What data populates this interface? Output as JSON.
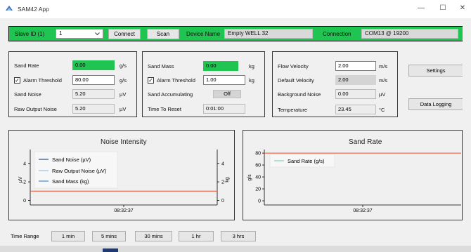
{
  "window": {
    "title": "SAM42 App",
    "minimize_glyph": "—",
    "maximize_glyph": "☐",
    "close_glyph": "✕"
  },
  "topbar": {
    "slave_id_label": "Slave ID (1)",
    "slave_id_value": "1",
    "connect_label": "Connect",
    "scan_label": "Scan",
    "device_name_label": "Device Name",
    "device_name_value": "Empty WELL 32",
    "connection_label": "Connection",
    "connection_value": "COM13 @ 19200"
  },
  "group1": {
    "sand_rate_label": "Sand Rate",
    "sand_rate_value": "0.00",
    "sand_rate_unit": "g/s",
    "alarm_threshold_label": "Alarm Threshold",
    "alarm_threshold_value": "80.00",
    "alarm_threshold_unit": "g/s",
    "sand_noise_label": "Sand Noise",
    "sand_noise_value": "5.20",
    "sand_noise_unit": "µV",
    "raw_output_label": "Raw Output Noise",
    "raw_output_value": "5.20",
    "raw_output_unit": "µV"
  },
  "group2": {
    "sand_mass_label": "Sand Mass",
    "sand_mass_value": "0.00",
    "sand_mass_unit": "kg",
    "alarm_threshold_label": "Alarm Threshold",
    "alarm_threshold_value": "1.00",
    "alarm_threshold_unit": "kg",
    "sand_accum_label": "Sand Accumulating",
    "sand_accum_button": "Off",
    "time_reset_label": "Time To Reset",
    "time_reset_value": "0:01:00"
  },
  "group3": {
    "flow_velocity_label": "Flow Velocity",
    "flow_velocity_value": "2.00",
    "flow_velocity_unit": "m/s",
    "default_velocity_label": "Default Velocity",
    "default_velocity_value": "2.00",
    "default_velocity_unit": "m/s",
    "background_noise_label": "Background Noise",
    "background_noise_value": "0.00",
    "background_noise_unit": "µV",
    "temperature_label": "Temperature",
    "temperature_value": "23.45",
    "temperature_unit": "°C"
  },
  "side_buttons": {
    "settings": "Settings",
    "data_logging": "Data Logging"
  },
  "colors": {
    "accent_green": "#1fc550",
    "line_red": "#ee4c2c",
    "legend_sand_noise": "#2a4d8f",
    "legend_raw_output": "#9cc3e6",
    "legend_sand_mass": "#3b8fd6",
    "legend_sand_rate": "#7fd0a8"
  },
  "time_range": {
    "label": "Time Range",
    "options": [
      "1 min",
      "5 mins",
      "30 mins",
      "1 hr",
      "3 hrs"
    ]
  },
  "chart_data": [
    {
      "type": "line",
      "title": "Noise Intensity",
      "x_tick_labels": [
        "08:32:37"
      ],
      "ylabel_left": "µV",
      "ylabel_right": "kg",
      "y_ticks_left": [
        "0",
        "2",
        "4"
      ],
      "y_ticks_right": [
        "0",
        "2",
        "4"
      ],
      "ylim": [
        -0.5,
        5.5
      ],
      "legend_placement": "top-left",
      "series": [
        {
          "name": "Sand Noise (µV)",
          "values": []
        },
        {
          "name": "Raw Output Noise (µV)",
          "values": []
        },
        {
          "name": "Sand Mass (kg)",
          "values": []
        }
      ],
      "reference_line": {
        "value": 1.0,
        "color": "#ee4c2c"
      }
    },
    {
      "type": "line",
      "title": "Sand Rate",
      "x_tick_labels": [
        "08:32:37"
      ],
      "ylabel": "g/s",
      "y_ticks": [
        "0",
        "20",
        "40",
        "60",
        "80"
      ],
      "ylim": [
        -7,
        86
      ],
      "legend_placement": "top-left",
      "series": [
        {
          "name": "Sand Rate (g/s)",
          "values": []
        }
      ],
      "reference_line": {
        "value": 80,
        "color": "#ee4c2c"
      }
    }
  ]
}
